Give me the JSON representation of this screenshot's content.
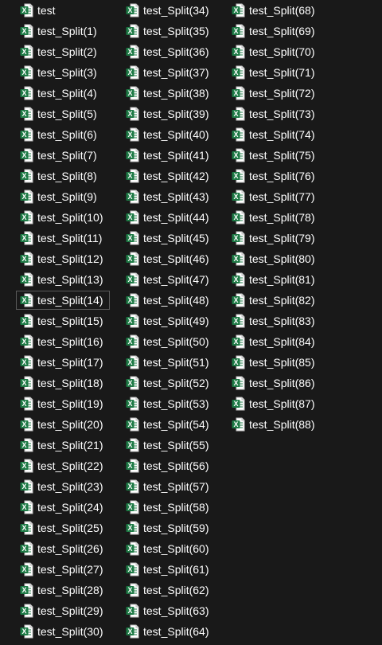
{
  "window": {
    "view": "list",
    "background_color": "#191919",
    "text_color": "#ffffff",
    "focused_item": "test_Split(14)"
  },
  "file_icon": {
    "name": "excel-file-icon",
    "badge_text": "X",
    "badge_color": "#1d7a45",
    "page_color": "#ffffff"
  },
  "files": [
    "test",
    "test_Split(1)",
    "test_Split(2)",
    "test_Split(3)",
    "test_Split(4)",
    "test_Split(5)",
    "test_Split(6)",
    "test_Split(7)",
    "test_Split(8)",
    "test_Split(9)",
    "test_Split(10)",
    "test_Split(11)",
    "test_Split(12)",
    "test_Split(13)",
    "test_Split(14)",
    "test_Split(15)",
    "test_Split(16)",
    "test_Split(17)",
    "test_Split(18)",
    "test_Split(19)",
    "test_Split(20)",
    "test_Split(21)",
    "test_Split(22)",
    "test_Split(23)",
    "test_Split(24)",
    "test_Split(25)",
    "test_Split(26)",
    "test_Split(27)",
    "test_Split(28)",
    "test_Split(29)",
    "test_Split(30)",
    "test_Split(34)",
    "test_Split(35)",
    "test_Split(36)",
    "test_Split(37)",
    "test_Split(38)",
    "test_Split(39)",
    "test_Split(40)",
    "test_Split(41)",
    "test_Split(42)",
    "test_Split(43)",
    "test_Split(44)",
    "test_Split(45)",
    "test_Split(46)",
    "test_Split(47)",
    "test_Split(48)",
    "test_Split(49)",
    "test_Split(50)",
    "test_Split(51)",
    "test_Split(52)",
    "test_Split(53)",
    "test_Split(54)",
    "test_Split(55)",
    "test_Split(56)",
    "test_Split(57)",
    "test_Split(58)",
    "test_Split(59)",
    "test_Split(60)",
    "test_Split(61)",
    "test_Split(62)",
    "test_Split(63)",
    "test_Split(64)",
    "test_Split(68)",
    "test_Split(69)",
    "test_Split(70)",
    "test_Split(71)",
    "test_Split(72)",
    "test_Split(73)",
    "test_Split(74)",
    "test_Split(75)",
    "test_Split(76)",
    "test_Split(77)",
    "test_Split(78)",
    "test_Split(79)",
    "test_Split(80)",
    "test_Split(81)",
    "test_Split(82)",
    "test_Split(83)",
    "test_Split(84)",
    "test_Split(85)",
    "test_Split(86)",
    "test_Split(87)",
    "test_Split(88)"
  ]
}
